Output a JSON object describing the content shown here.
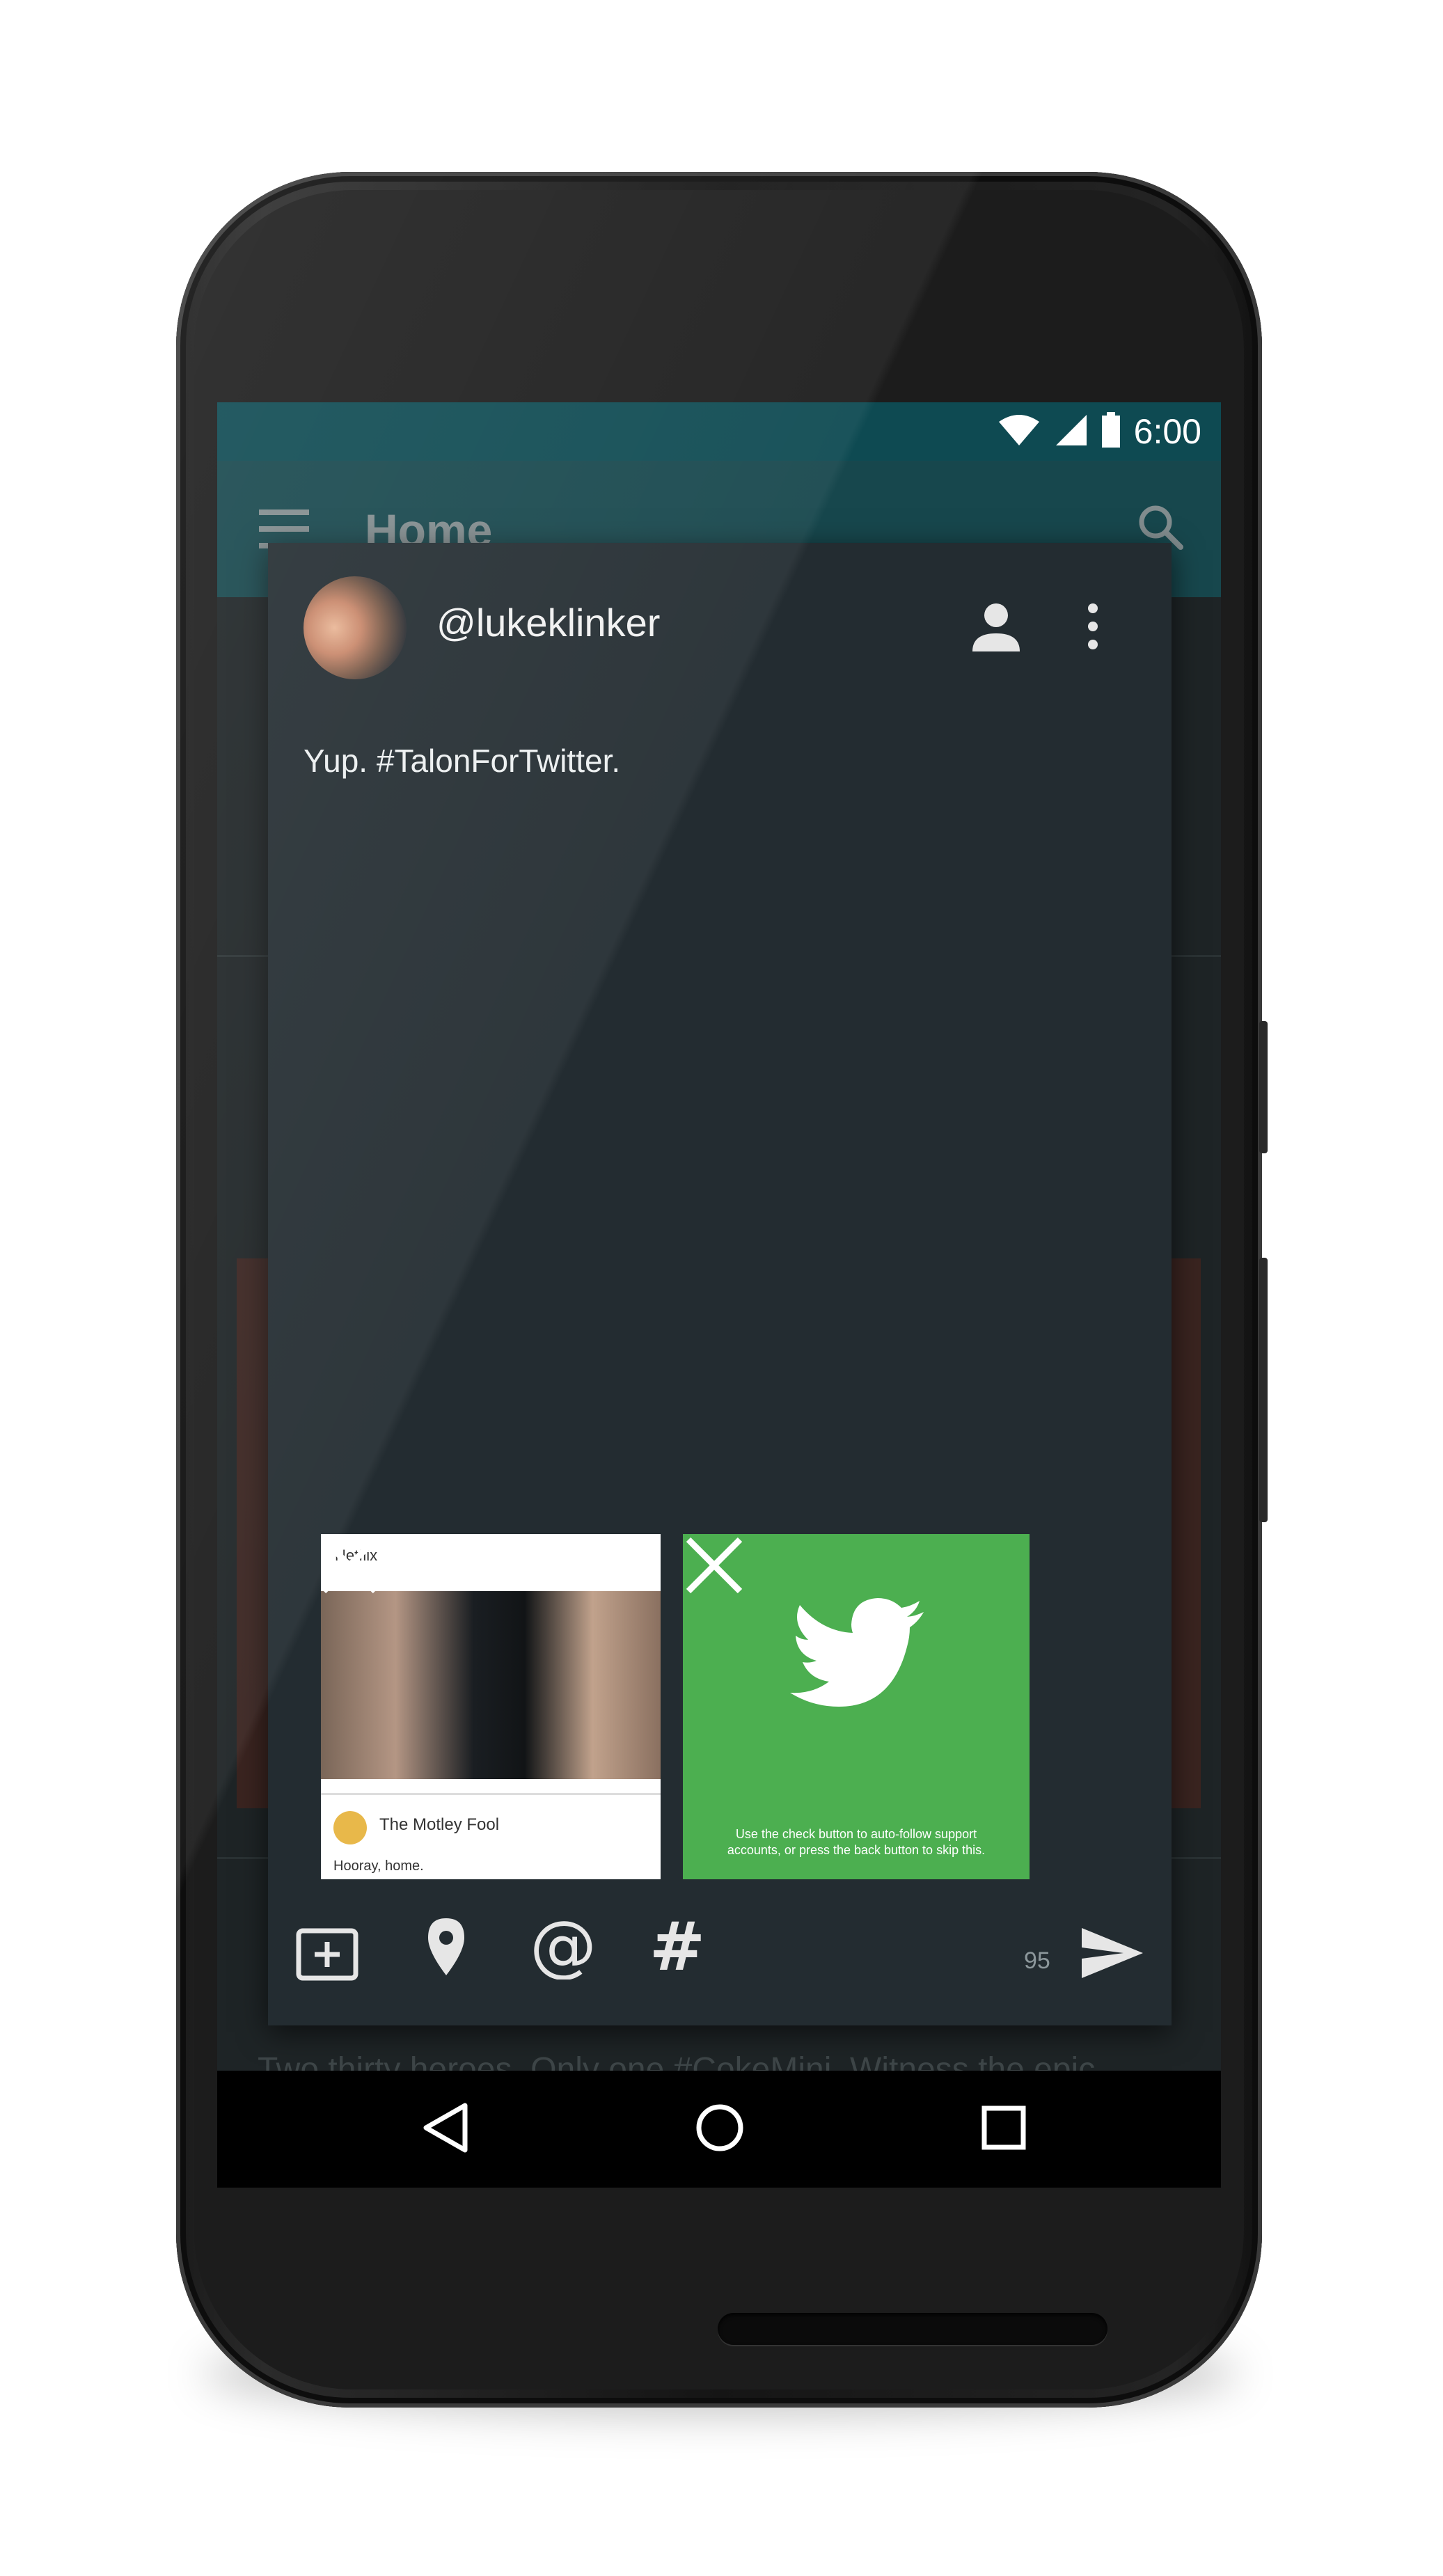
{
  "status_bar": {
    "time": "6:00"
  },
  "app_bar": {
    "title": "Home"
  },
  "background_tweet": {
    "text": "Two thirty heroes. Only one #CokeMini. Witness the epic"
  },
  "compose": {
    "username": "@lukeklinker",
    "tweet_text": "Yup. #TalonForTwitter.",
    "char_count": "95",
    "attachments": [
      {
        "header_text": "Netflix",
        "account": "The Motley Fool",
        "body": "Hooray, home."
      },
      {
        "caption": "Use the check button to auto-follow support accounts, or press the back button to skip this."
      }
    ]
  },
  "colors": {
    "status_bar": "#0e4a52",
    "app_bar": "#12646d",
    "dialog_bg": "#232c31",
    "attachment_green": "#4caf50"
  },
  "icons": [
    "wifi-icon",
    "cell-signal-icon",
    "battery-icon",
    "menu-icon",
    "search-icon",
    "profile-icon",
    "more-vert-icon",
    "close-icon",
    "add-image-icon",
    "location-icon",
    "mention-icon",
    "hashtag-icon",
    "send-icon",
    "back-icon",
    "home-icon",
    "recents-icon",
    "twitter-bird-icon"
  ]
}
